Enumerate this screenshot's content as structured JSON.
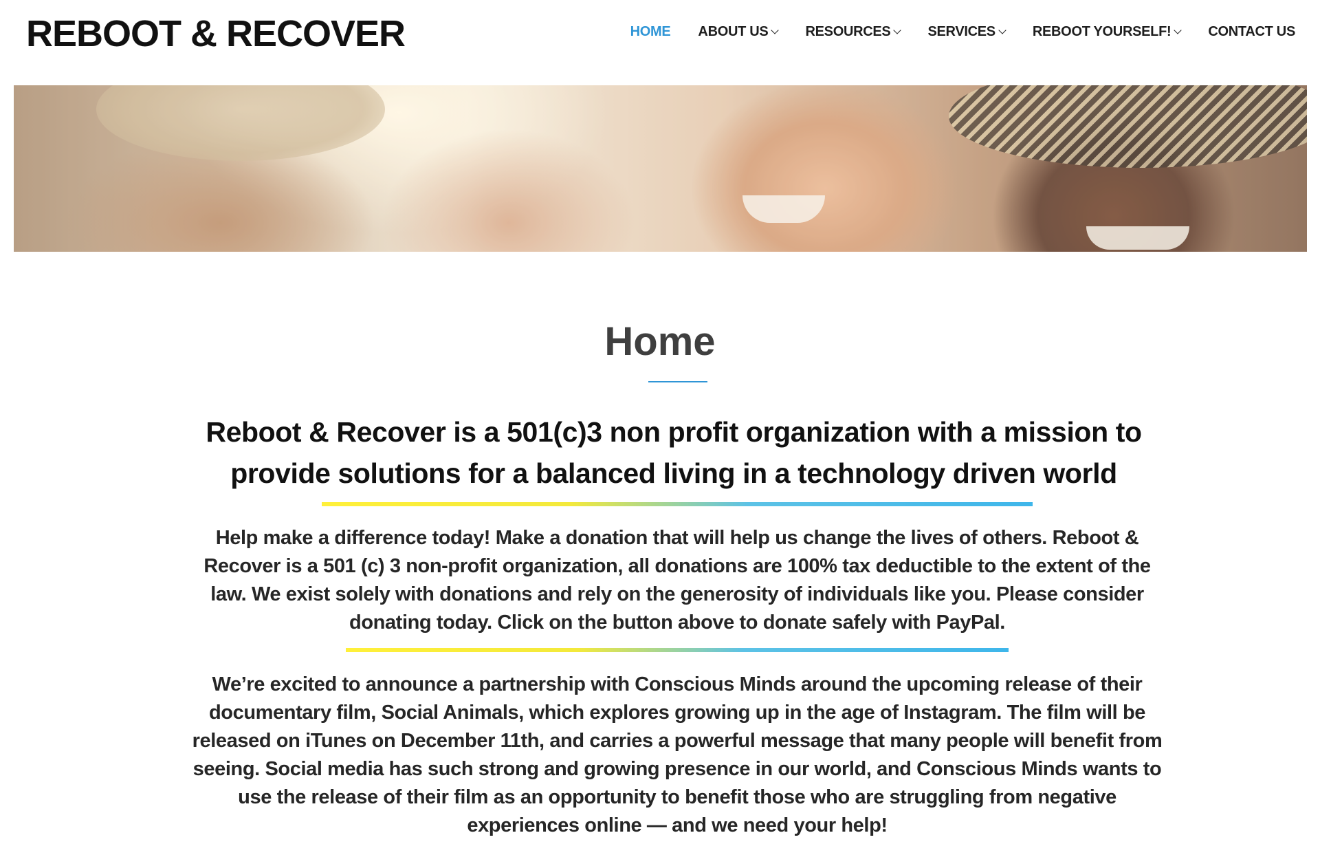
{
  "site": {
    "logo": "REBOOT & RECOVER"
  },
  "nav": {
    "items": [
      {
        "label": "HOME",
        "active": true,
        "has_dropdown": false
      },
      {
        "label": "ABOUT US",
        "active": false,
        "has_dropdown": true
      },
      {
        "label": "RESOURCES",
        "active": false,
        "has_dropdown": true
      },
      {
        "label": "SERVICES",
        "active": false,
        "has_dropdown": true
      },
      {
        "label": "REBOOT YOURSELF!",
        "active": false,
        "has_dropdown": true
      },
      {
        "label": "CONTACT US",
        "active": false,
        "has_dropdown": false
      }
    ],
    "active_color": "#2f95d6"
  },
  "main": {
    "title": "Home",
    "mission": "Reboot & Recover is a 501(c)3  non profit organization with a mission to provide solutions for a balanced living in a technology driven world",
    "donation_text": "Help make a difference today! Make a donation that will help us change the lives of others. Reboot & Recover is a 501 (c) 3 non-profit organization, all donations are 100% tax deductible to the extent of the law. We exist solely with donations and rely on the generosity of individuals like you. Please consider donating today. Click on the button above to donate safely with PayPal.",
    "partnership_text": "We’re excited to announce a partnership with Conscious Minds around the upcoming release of their documentary film, Social Animals, which explores growing up in the age of Instagram. The film will be released on iTunes on December 11th, and carries a powerful message that many people will benefit from seeing. Social media has such strong and growing presence in our world, and Conscious Minds wants to use the release of their film as an opportunity to benefit those who are struggling from negative experiences online — and we need your help!"
  },
  "colors": {
    "accent_blue": "#2f95d6",
    "rule_yellow": "#fff03a",
    "rule_blue": "#3eb6ea"
  }
}
